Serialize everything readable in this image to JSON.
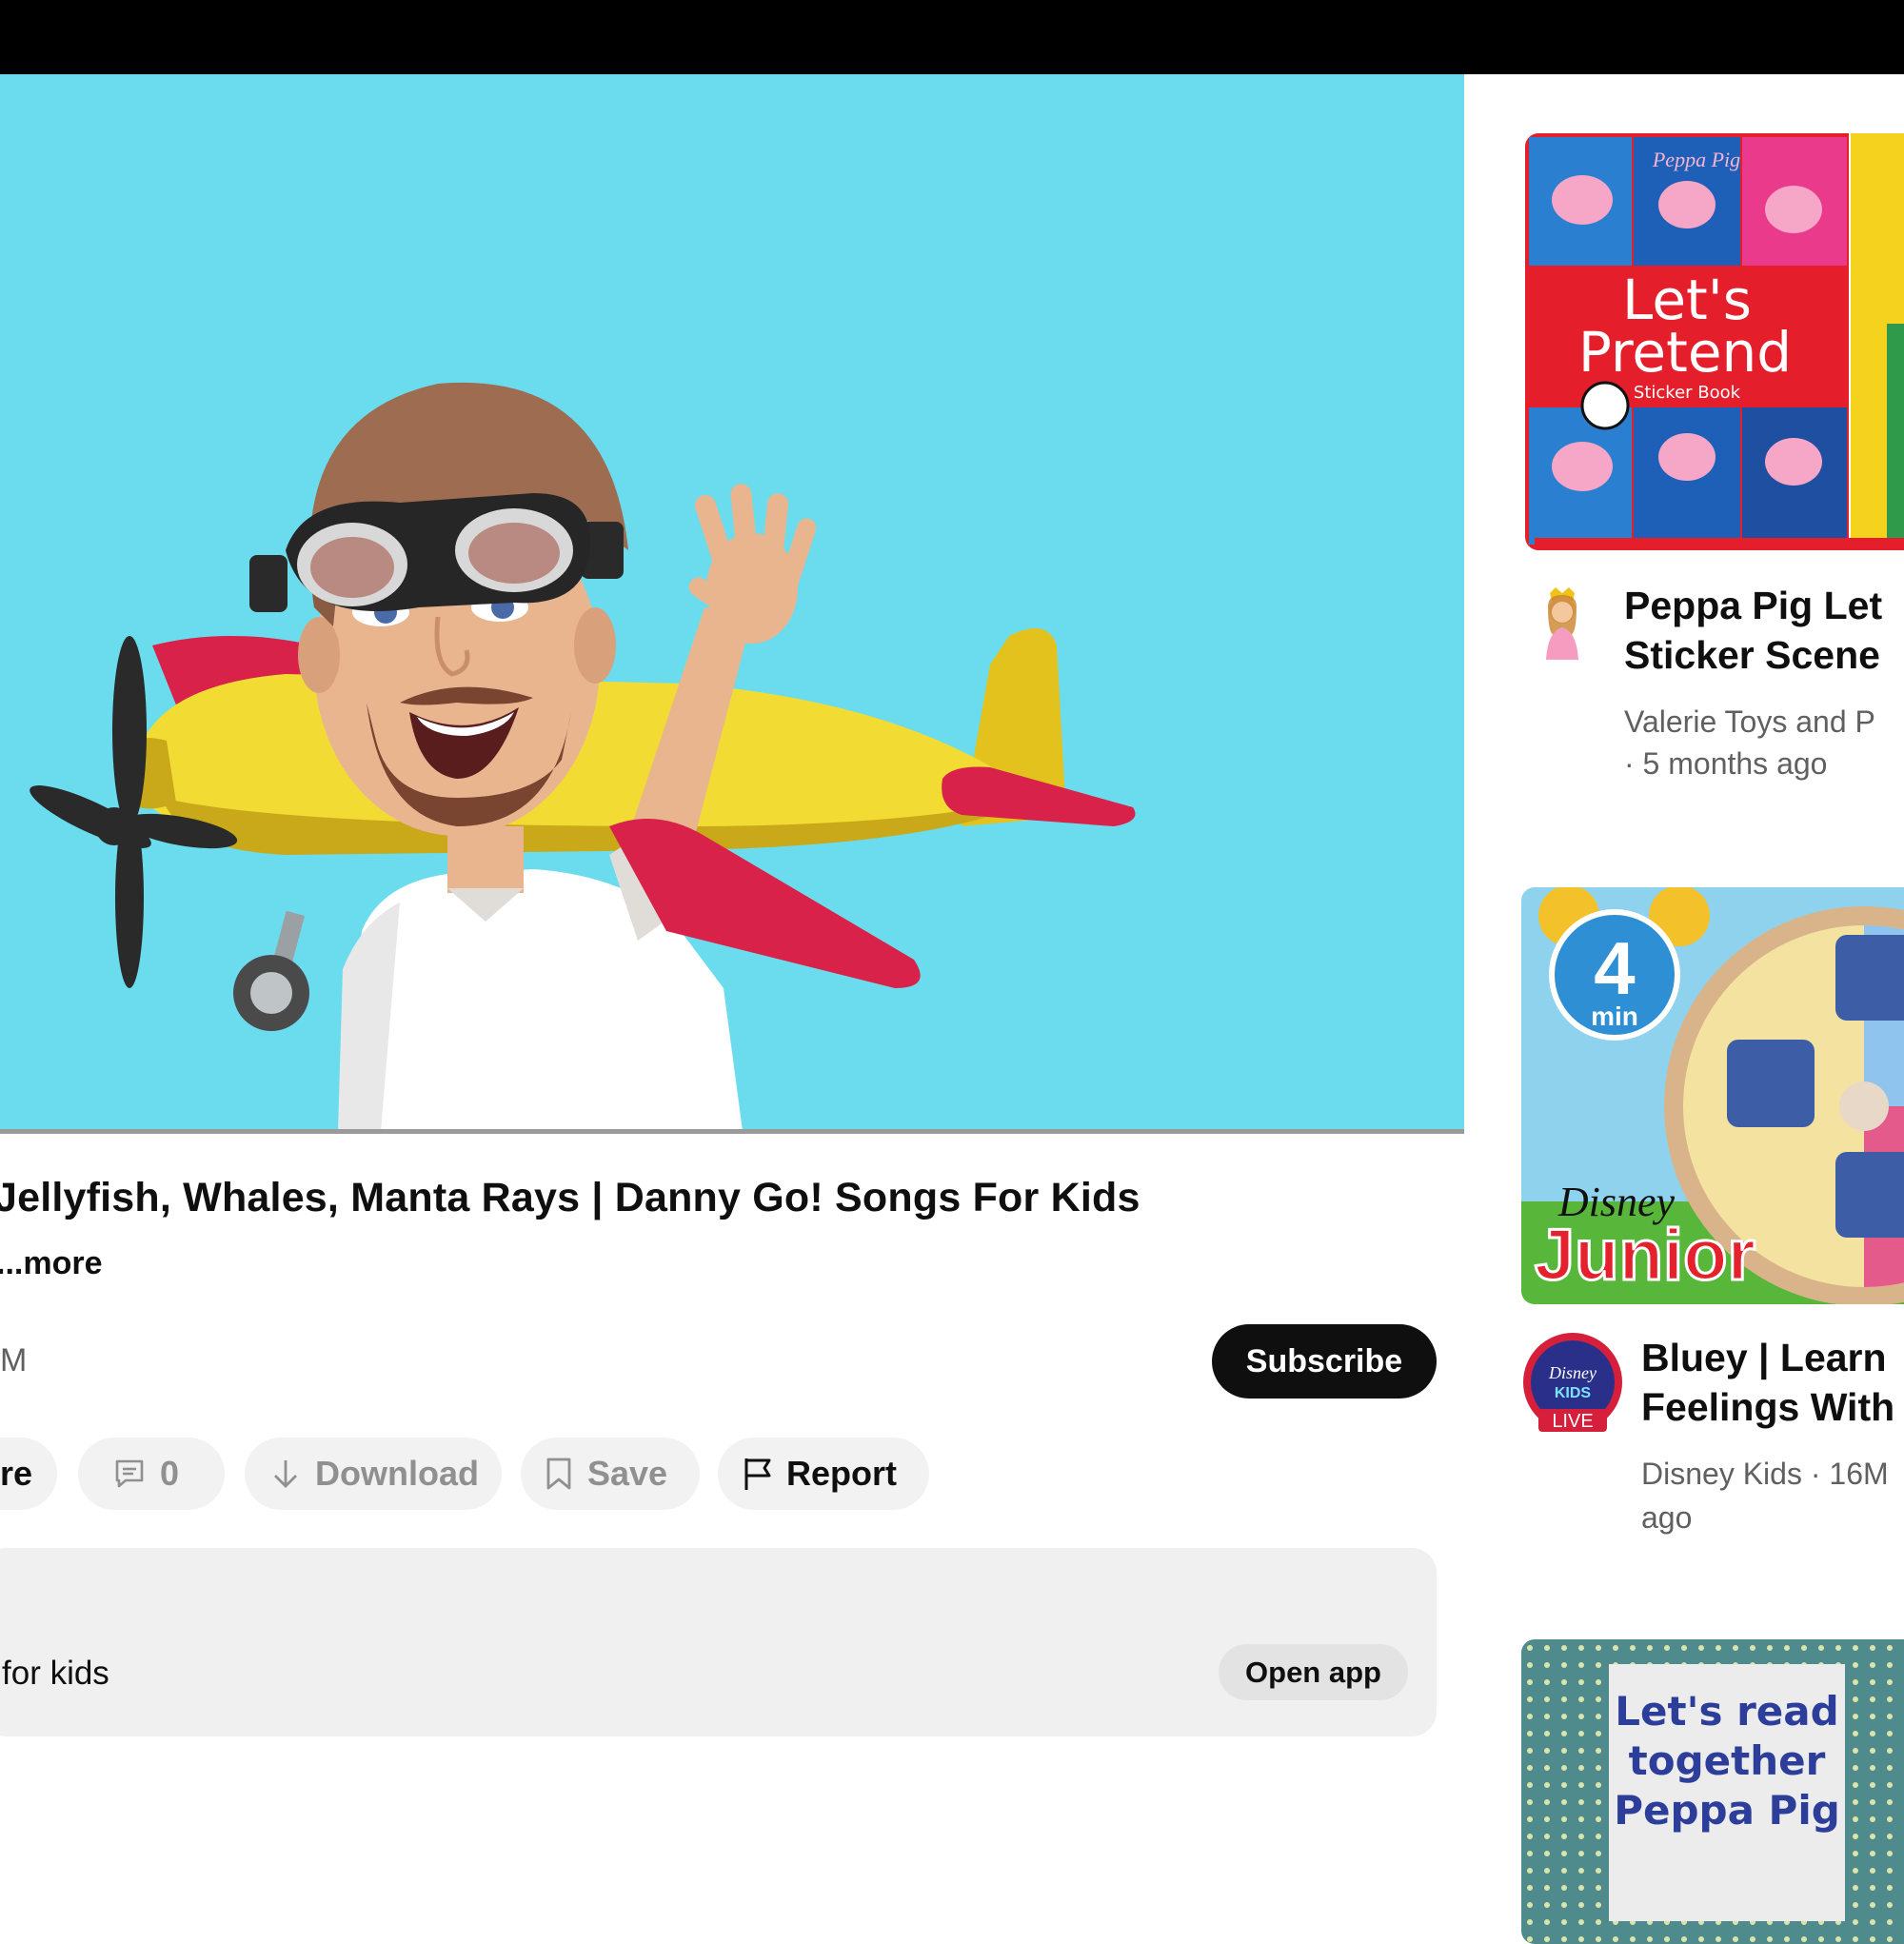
{
  "video": {
    "title": "Jellyfish, Whales, Manta Rays | Danny Go! Songs For Kids",
    "more_label": "...more",
    "subscriber_count": "M",
    "subscribe_label": "Subscribe"
  },
  "actions": {
    "share_label": "re",
    "comments_count": "0",
    "download_label": "Download",
    "save_label": "Save",
    "report_label": "Report"
  },
  "info_card": {
    "label": "for kids",
    "open_app_label": "Open app"
  },
  "suggestions": [
    {
      "title_line1": "Peppa Pig Let",
      "title_line2": "Sticker Scene",
      "channel": "Valerie Toys and P",
      "age": "· 5 months ago",
      "thumb_brand": "Peppa Pig",
      "thumb_line1": "Let's",
      "thumb_line2": "Pretend",
      "thumb_sub": "Sticker Book"
    },
    {
      "title_line1": "Bluey | Learn",
      "title_line2": "Feelings With",
      "channel": "Disney Kids · 16M",
      "age": "ago",
      "thumb_duration_num": "4",
      "thumb_duration_unit": "min",
      "thumb_brand_top": "Disney",
      "thumb_brand_bottom": "Junior",
      "avatar_badge": "LIVE",
      "avatar_text_top": "Disney",
      "avatar_text_bottom": "KIDS"
    },
    {
      "thumb_line1": "Let's read",
      "thumb_line2": "together",
      "thumb_line3": "Peppa Pig"
    }
  ],
  "colors": {
    "player_bg": "#6adced",
    "subscribe_bg": "#0f0f0f",
    "pill_bg": "#f2f2f2",
    "muted_text": "#606060"
  }
}
